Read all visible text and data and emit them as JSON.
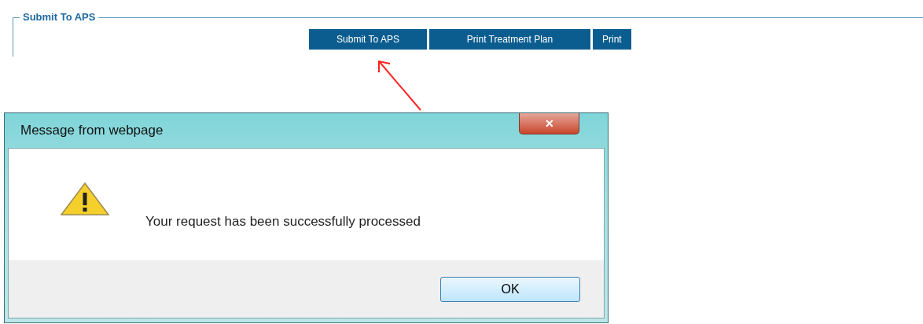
{
  "section": {
    "legend": "Submit To APS"
  },
  "buttons": [
    {
      "label": "Submit To APS"
    },
    {
      "label": "Print Treatment Plan"
    },
    {
      "label": "Print"
    }
  ],
  "dialog": {
    "title": "Message from webpage",
    "close_label": "✕",
    "message": "Your request has been successfully processed",
    "ok_label": "OK"
  }
}
